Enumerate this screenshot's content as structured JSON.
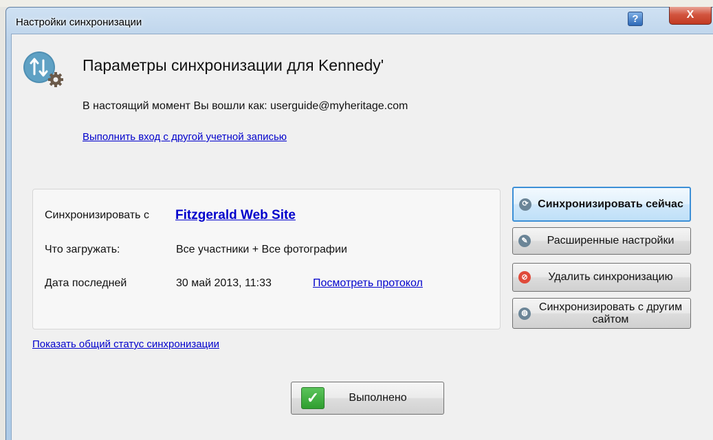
{
  "window": {
    "title": "Настройки синхронизации",
    "help_glyph": "?",
    "close_glyph": "X"
  },
  "header": {
    "heading": "Параметры синхронизации для Kennedy'",
    "logged_in_text": "В настоящий момент Вы вошли как: userguide@myheritage.com",
    "other_account_link": "Выполнить вход с другой учетной записью",
    "icon": "sync-settings-icon"
  },
  "panel": {
    "sync_with_label": "Синхронизировать с",
    "site_link": "Fitzgerald Web Site",
    "what_label": "Что загружать:",
    "what_value": "Все участники + Все фотографии",
    "date_label": "Дата последней",
    "date_value": "30 май 2013, 11:33",
    "log_link": "Посмотреть протокол"
  },
  "actions": {
    "sync_now": "Синхронизировать сейчас",
    "advanced": "Расширенные настройки",
    "delete_sync": "Удалить синхронизацию",
    "sync_other": "Синхронизировать с другим сайтом"
  },
  "status_link": "Показать общий статус синхронизации",
  "done_button": "Выполнено",
  "colors": {
    "link": "#0000cc",
    "primary_border": "#3c8fd6",
    "close": "#c23a22",
    "check": "#2f9e2f"
  }
}
